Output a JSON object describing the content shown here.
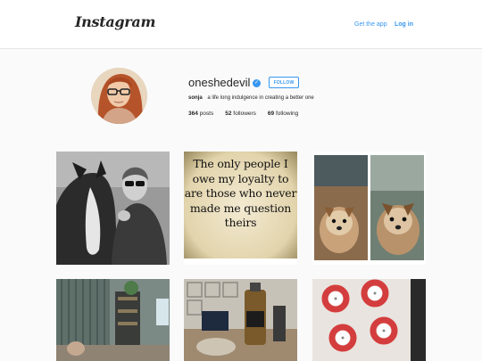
{
  "header": {
    "logo_text": "Instagram",
    "get_app_label": "Get the app",
    "login_label": "Log in"
  },
  "profile": {
    "username": "oneshedevil",
    "verified_glyph": "✓",
    "follow_label": "FOLLOW",
    "full_name": "sonja",
    "bio": "a life long indulgence in creating a better one",
    "posts_count": "364",
    "posts_label": "posts",
    "followers_count": "52",
    "followers_label": "followers",
    "following_count": "69",
    "following_label": "following"
  },
  "posts": {
    "quote_text": "The only people I owe my loyalty to are those who never made me question theirs"
  },
  "colors": {
    "accent": "#3897f0",
    "background": "#fafafa"
  }
}
